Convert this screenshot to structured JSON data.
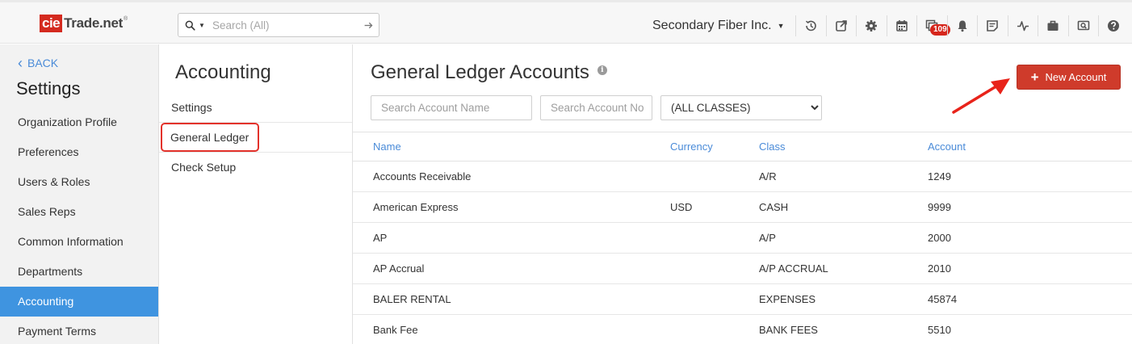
{
  "app": {
    "logo_cie": "cie",
    "logo_rest": "Trade.net",
    "logo_mark": "®"
  },
  "search": {
    "placeholder": "Search (All)"
  },
  "company": {
    "name": "Secondary Fiber Inc."
  },
  "toolbar": {
    "icons": [
      "history-icon",
      "external-link-icon",
      "gear-icon",
      "calendar-icon",
      "messages-icon",
      "bell-icon",
      "notes-icon",
      "activity-icon",
      "briefcase-icon",
      "screen-search-icon",
      "help-icon"
    ],
    "messages_badge": "109"
  },
  "sidebar": {
    "back_label": "BACK",
    "title": "Settings",
    "items": [
      {
        "label": "Organization Profile",
        "active": false
      },
      {
        "label": "Preferences",
        "active": false
      },
      {
        "label": "Users & Roles",
        "active": false
      },
      {
        "label": "Sales Reps",
        "active": false
      },
      {
        "label": "Common Information",
        "active": false
      },
      {
        "label": "Departments",
        "active": false
      },
      {
        "label": "Accounting",
        "active": true
      },
      {
        "label": "Payment Terms",
        "active": false
      }
    ],
    "active_color": "#3f94e0"
  },
  "midpanel": {
    "title": "Accounting",
    "items": [
      {
        "label": "Settings",
        "selected": false
      },
      {
        "label": "General Ledger",
        "selected": true
      },
      {
        "label": "Check Setup",
        "selected": false
      }
    ]
  },
  "main": {
    "title": "General Ledger Accounts",
    "new_button_label": "New Account",
    "brand_color": "#cf3b2b",
    "filters": {
      "account_name_placeholder": "Search Account Name",
      "account_no_placeholder": "Search Account No",
      "class_selected": "(ALL CLASSES)"
    },
    "table": {
      "headers": {
        "name": "Name",
        "currency": "Currency",
        "class": "Class",
        "account": "Account"
      },
      "rows": [
        {
          "name": "Accounts Receivable",
          "currency": "",
          "class": "A/R",
          "account": "1249"
        },
        {
          "name": "American Express",
          "currency": "USD",
          "class": "CASH",
          "account": "9999"
        },
        {
          "name": "AP",
          "currency": "",
          "class": "A/P",
          "account": "2000"
        },
        {
          "name": "AP Accrual",
          "currency": "",
          "class": "A/P ACCRUAL",
          "account": "2010"
        },
        {
          "name": "BALER RENTAL",
          "currency": "",
          "class": "EXPENSES",
          "account": "45874"
        },
        {
          "name": "Bank Fee",
          "currency": "",
          "class": "BANK FEES",
          "account": "5510"
        }
      ]
    }
  }
}
